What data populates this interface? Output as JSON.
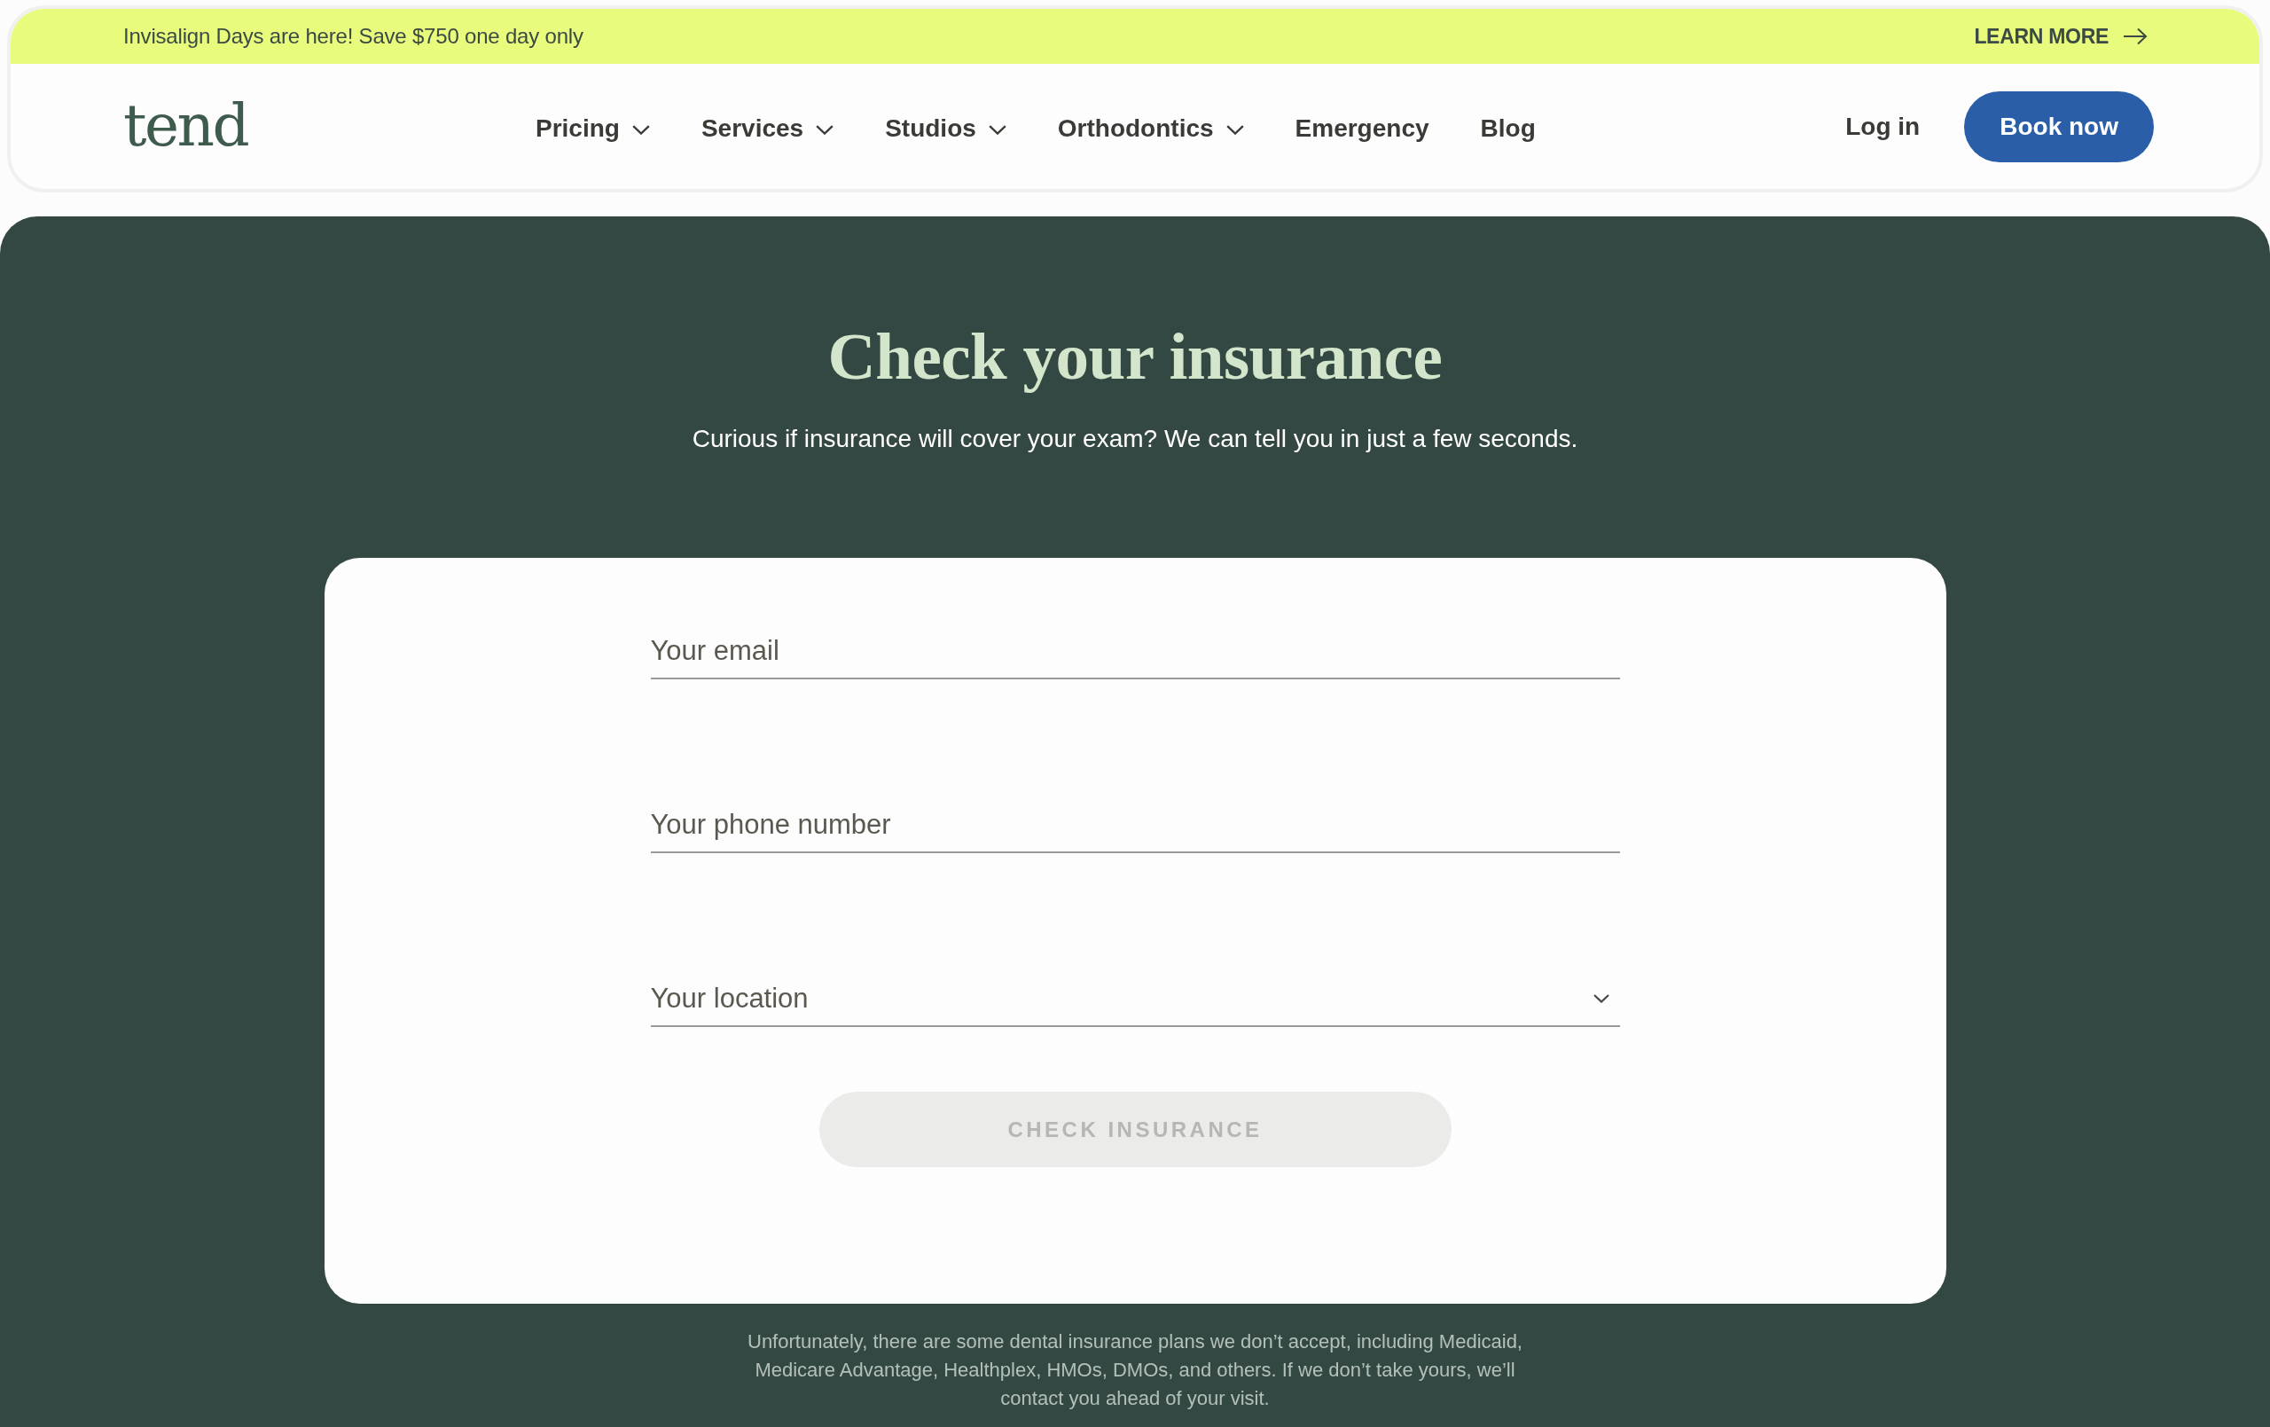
{
  "banner": {
    "text": "Invisalign Days are here! Save $750 one day only",
    "link": "LEARN MORE"
  },
  "header": {
    "logo": "tend",
    "nav": [
      {
        "label": "Pricing",
        "dropdown": true
      },
      {
        "label": "Services",
        "dropdown": true
      },
      {
        "label": "Studios",
        "dropdown": true
      },
      {
        "label": "Orthodontics",
        "dropdown": true
      },
      {
        "label": "Emergency",
        "dropdown": false
      },
      {
        "label": "Blog",
        "dropdown": false
      }
    ],
    "login": "Log in",
    "cta": "Book now"
  },
  "hero": {
    "title": "Check your insurance",
    "subtitle": "Curious if insurance will cover your exam? We can tell you in just a few seconds."
  },
  "form": {
    "fields": [
      {
        "kind": "input",
        "placeholder": "Your email"
      },
      {
        "kind": "input",
        "placeholder": "Your phone number"
      },
      {
        "kind": "select",
        "placeholder": "Your location"
      }
    ],
    "submit": {
      "label": "CHECK INSURANCE",
      "disabled": true
    }
  },
  "disclaimer": "Unfortunately, there are some dental insurance plans we don’t accept, including Medicaid, Medicare Advantage, Healthplex, HMOs, DMOs, and others. If we don’t take yours, we’ll contact you ahead of your visit."
}
